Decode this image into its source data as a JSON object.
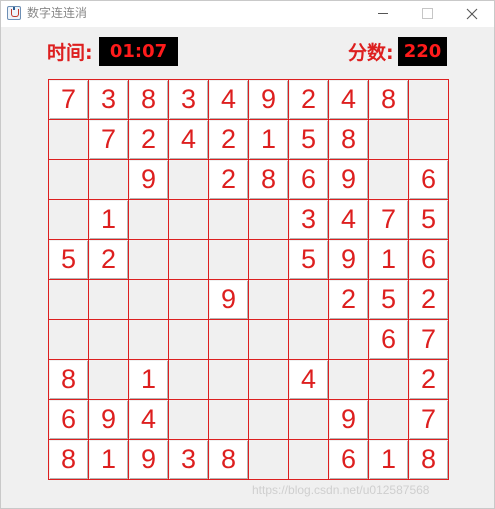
{
  "window": {
    "title": "数字连连消",
    "icon": "java-cup-icon"
  },
  "header": {
    "time_label": "时间:",
    "time_value": "01:07",
    "score_label": "分数:",
    "score_value": "220"
  },
  "colors": {
    "accent": "#dd1f1f",
    "value_bg": "#000000",
    "window_bg": "#f0f0f0"
  },
  "board": {
    "rows": 10,
    "cols": 10,
    "cells": [
      [
        "7",
        "3",
        "8",
        "3",
        "4",
        "9",
        "2",
        "4",
        "8",
        ""
      ],
      [
        "",
        "7",
        "2",
        "4",
        "2",
        "1",
        "5",
        "8",
        "",
        ""
      ],
      [
        "",
        "",
        "9",
        "",
        "2",
        "8",
        "6",
        "9",
        "",
        "6"
      ],
      [
        "",
        "1",
        "",
        "",
        "",
        "",
        "3",
        "4",
        "7",
        "5"
      ],
      [
        "5",
        "2",
        "",
        "",
        "",
        "",
        "5",
        "9",
        "1",
        "6"
      ],
      [
        "",
        "",
        "",
        "",
        "9",
        "",
        "",
        "2",
        "5",
        "2"
      ],
      [
        "",
        "",
        "",
        "",
        "",
        "",
        "",
        "",
        "6",
        "7"
      ],
      [
        "8",
        "",
        "1",
        "",
        "",
        "",
        "4",
        "",
        "",
        "2"
      ],
      [
        "6",
        "9",
        "4",
        "",
        "",
        "",
        "",
        "9",
        "",
        "7"
      ],
      [
        "8",
        "1",
        "9",
        "3",
        "8",
        "",
        "",
        "6",
        "1",
        "8"
      ]
    ]
  },
  "watermark": "https://blog.csdn.net/u012587568"
}
